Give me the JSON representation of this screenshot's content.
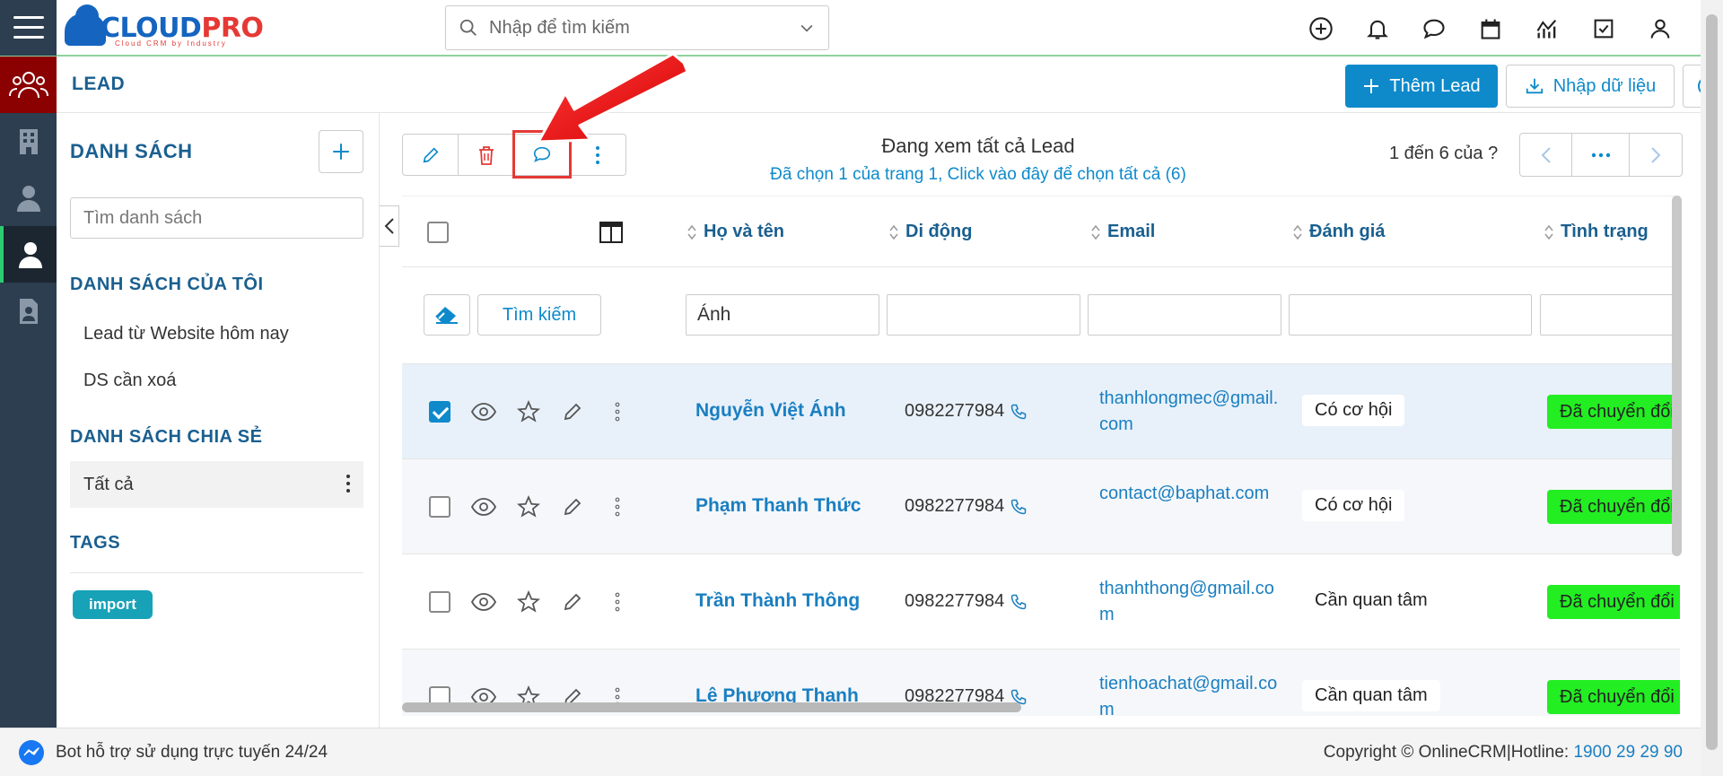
{
  "app": {
    "logo_main": "CLOUD",
    "logo_accent": "PRO",
    "logo_tagline": "Cloud CRM by Industry"
  },
  "search": {
    "placeholder": "Nhập để tìm kiếm"
  },
  "module": {
    "title": "LEAD",
    "add_button": "Thêm Lead",
    "import_button": "Nhập dữ liệu"
  },
  "sidebar": {
    "title": "DANH SÁCH",
    "search_placeholder": "Tìm danh sách",
    "my_lists_title": "DANH SÁCH CỦA TÔI",
    "my_lists": [
      {
        "label": "Lead từ Website hôm nay"
      },
      {
        "label": "DS cần xoá"
      }
    ],
    "shared_title": "DANH SÁCH CHIA SẺ",
    "shared_lists": [
      {
        "label": "Tất cả"
      }
    ],
    "tags_title": "TAGS",
    "tags": [
      {
        "label": "import"
      }
    ]
  },
  "listview": {
    "viewing_prefix": "Đang xem tất cả",
    "viewing_module": "Lead",
    "selection_text": "Đã chọn 1 của trang 1, Click vào đây để chọn tất cả (6)",
    "pager_text": "1 đến 6 của",
    "pager_unknown": "?"
  },
  "columns": [
    {
      "label": "Họ và tên"
    },
    {
      "label": "Di động"
    },
    {
      "label": "Email"
    },
    {
      "label": "Đánh giá"
    },
    {
      "label": "Tình trạng"
    }
  ],
  "filters": {
    "search_button": "Tìm kiếm",
    "name_value": "Ánh"
  },
  "rows": [
    {
      "name": "Nguyễn Việt Ánh",
      "phone": "0982277984",
      "email": "thanhlongmec@gmail.com",
      "rating": "Có cơ hội",
      "status": "Đã chuyển đổi",
      "selected": true
    },
    {
      "name": "Phạm Thanh Thức",
      "phone": "0982277984",
      "email": "contact@baphat.com",
      "rating": "Có cơ hội",
      "status": "Đã chuyển đổi",
      "selected": false
    },
    {
      "name": "Trần Thành Thông",
      "phone": "0982277984",
      "email": "thanhthong@gmail.com",
      "rating": "Cần quan tâm",
      "status": "Đã chuyển đổi",
      "selected": false
    },
    {
      "name": "Lê Phương Thanh",
      "phone": "0982277984",
      "email": "tienhoachat@gmail.com",
      "rating": "Cần quan tâm",
      "status": "Đã chuyển đổi",
      "selected": false
    }
  ],
  "footer": {
    "bot_text": "Bot hỗ trợ sử dụng trực tuyến 24/24",
    "copyright": "Copyright © OnlineCRM|Hotline: ",
    "hotline": "1900 29 29 90"
  },
  "colors": {
    "primary": "#0e8acb",
    "title_blue": "#1a5f8f",
    "status_green": "#22ee22",
    "highlight_red": "#e53935",
    "rail_bg": "#2c3e50"
  }
}
